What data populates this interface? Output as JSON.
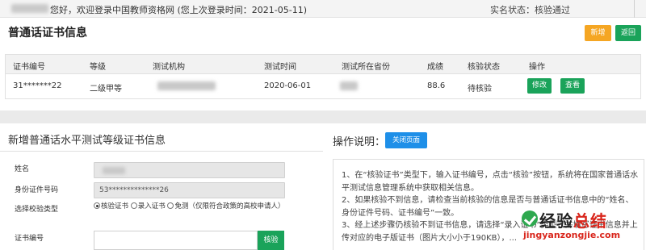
{
  "topbar": {
    "welcome": "您好，欢迎登录中国教师资格网 (您上次登录时间：2021-05-11)",
    "status": "实名状态：核验通过"
  },
  "page": {
    "title": "普通话证书信息",
    "add_label": "新增",
    "back_label": "返回"
  },
  "table": {
    "headers": [
      "证书编号",
      "等级",
      "测试机构",
      "测试时间",
      "测试所在省份",
      "成绩",
      "核验状态",
      "操作"
    ],
    "rows": [
      {
        "cert_no": "31*******22",
        "level": "二级甲等",
        "org": "",
        "date": "2020-06-01",
        "province": "",
        "score": "88.6",
        "status": "待核验",
        "modify": "修改",
        "view": "查看"
      }
    ]
  },
  "form": {
    "title": "新增普通话水平测试等级证书信息",
    "name_label": "姓名",
    "name_value": "",
    "id_label": "身份证件号码",
    "id_value": "53**************26",
    "type_label": "选择校验类型",
    "options": [
      "核验证书",
      "录入证书",
      "免测（仅限符合政策的高校申请人）"
    ],
    "selected_option": "核验证书",
    "cert_label": "证书编号",
    "cert_value": "",
    "verify_label": "核验"
  },
  "instructions": {
    "title": "操作说明：",
    "close_label": "关闭页面",
    "lines": [
      "1、在“核验证书”类型下，输入证书编号，点击“核验”按钮，系统将在国家普通话水平测试信息管理系统中获取相关信息。",
      "2、如果核验不到信息，请检查当前核验的信息是否与普通话证书信息中的“姓名、身份证件号码、证书编号”一致。",
      "3、经上述步骤仍核验不到证书信息，请选择“录入证书”类型，并填写证书信息并上传对应的电子版证书（图片大小小于190KB），..."
    ]
  },
  "watermark": {
    "cn_a": "经验",
    "cn_b": "总结",
    "en": "jingyanzongjie.com"
  },
  "colors": {
    "green": "#1aa35a",
    "orange": "#f5a623",
    "blue": "#1e8fe8"
  }
}
